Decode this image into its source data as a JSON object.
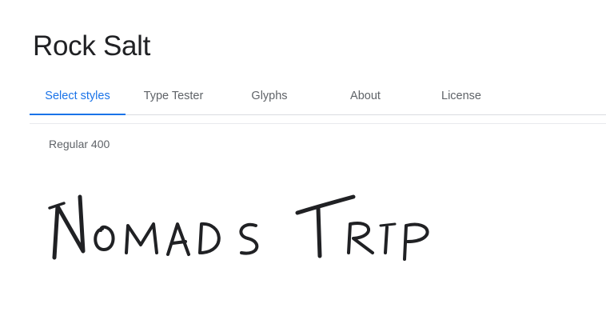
{
  "font": {
    "name": "Rock Salt"
  },
  "tabs": [
    {
      "label": "Select styles",
      "active": true
    },
    {
      "label": "Type Tester",
      "active": false
    },
    {
      "label": "Glyphs",
      "active": false
    },
    {
      "label": "About",
      "active": false
    },
    {
      "label": "License",
      "active": false
    }
  ],
  "style": {
    "label": "Regular 400"
  },
  "preview": {
    "text": "Nomads Trip"
  },
  "colors": {
    "accent": "#1a73e8",
    "text": "#202124",
    "muted": "#5f6368",
    "divider": "#dadce0"
  }
}
